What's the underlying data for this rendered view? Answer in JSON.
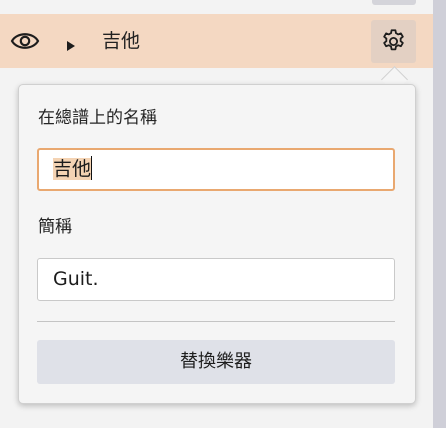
{
  "instrument": {
    "name": "吉他",
    "eye_icon": "eye-icon",
    "expand_icon": "triangle-right-icon",
    "settings_icon": "gear-icon"
  },
  "popover": {
    "full_name_label": "在總譜上的名稱",
    "full_name_value": "吉他",
    "short_name_label": "簡稱",
    "short_name_value": "Guit.",
    "replace_button_label": "替換樂器"
  },
  "colors": {
    "selected_row": "#f4d8c2",
    "focus_border": "#e9a870",
    "text_selection": "#f4d3b3",
    "button_bg": "#dfe1e8"
  }
}
